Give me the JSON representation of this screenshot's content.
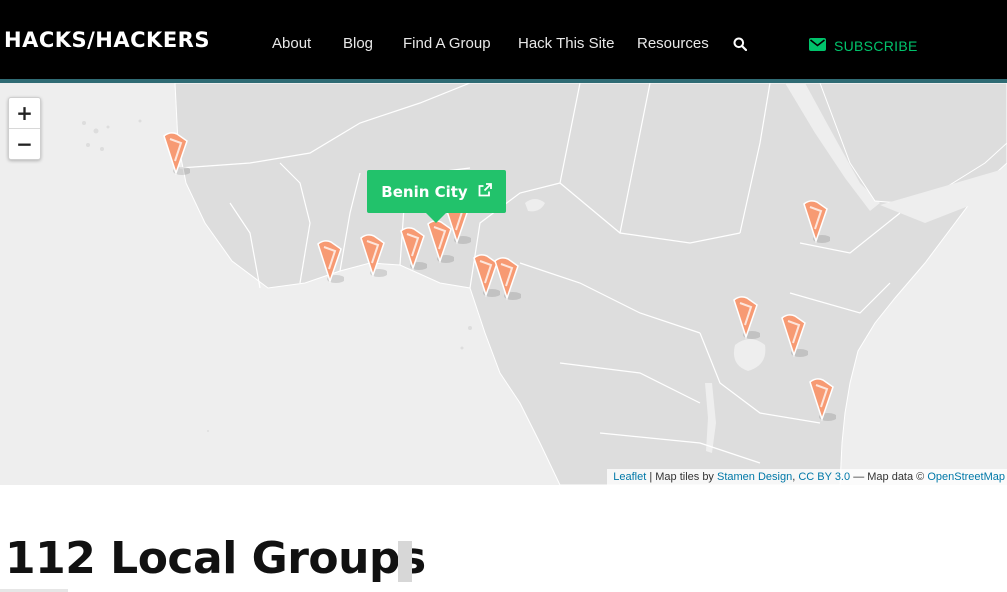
{
  "header": {
    "logo": "HACKS/HACKERS",
    "nav": [
      "About",
      "Blog",
      "Find A Group",
      "Hack This Site",
      "Resources"
    ],
    "search_icon": "search-icon",
    "subscribe_label": "SUBSCRIBE",
    "subscribe_icon": "envelope-icon",
    "accent_color": "#00c36b"
  },
  "map": {
    "zoom_in": "+",
    "zoom_out": "−",
    "popup": {
      "label": "Benin City",
      "icon": "external-link-icon",
      "color": "#22c26b"
    },
    "marker_color": "#f79a73",
    "land_color": "#dddddd",
    "water_color": "#eeeeee",
    "attribution": {
      "leaflet": "Leaflet",
      "tiles_by": "| Map tiles by",
      "stamen": "Stamen Design",
      "comma": ",",
      "license": "CC BY 3.0",
      "data": "— Map data ©",
      "osm": "OpenStreetMap"
    }
  },
  "section": {
    "title": "112 Local Groups"
  }
}
